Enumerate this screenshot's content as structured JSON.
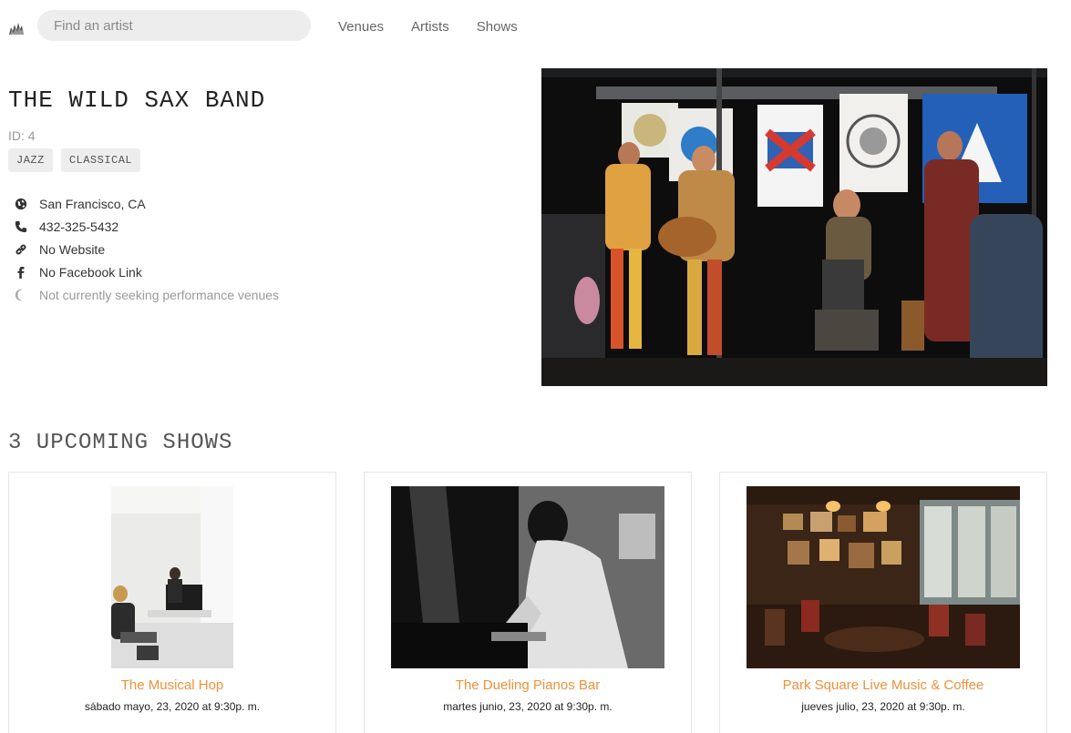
{
  "header": {
    "search_placeholder": "Find an artist",
    "nav": [
      "Venues",
      "Artists",
      "Shows"
    ]
  },
  "artist": {
    "name": "THE WILD SAX BAND",
    "id_text": "ID: 4",
    "genres": [
      "JAZZ",
      "CLASSICAL"
    ],
    "city": "San Francisco, CA",
    "phone": "432-325-5432",
    "website": "No Website",
    "facebook": "No Facebook Link",
    "seeking": "Not currently seeking performance venues"
  },
  "shows": {
    "title": "3 UPCOMING SHOWS",
    "items": [
      {
        "venue": "The Musical Hop",
        "time": "sábado mayo, 23, 2020 at 9:30p. m."
      },
      {
        "venue": "The Dueling Pianos Bar",
        "time": "martes junio, 23, 2020 at 9:30p. m."
      },
      {
        "venue": "Park Square Live Music & Coffee",
        "time": "jueves julio, 23, 2020 at 9:30p. m."
      }
    ]
  },
  "icons": {
    "logo": "fyyur-logo-icon",
    "city": "globe-icon",
    "phone": "phone-icon",
    "website": "link-icon",
    "facebook": "facebook-icon",
    "seeking": "moon-icon"
  },
  "colors": {
    "venue_link": "#f0913a",
    "search_bg": "#ededed",
    "genre_bg": "#ededed"
  }
}
